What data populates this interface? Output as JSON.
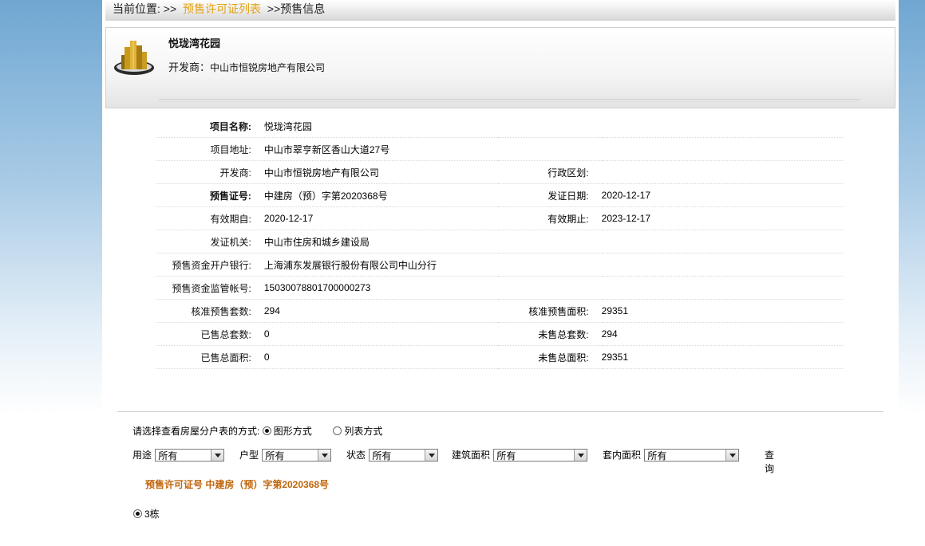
{
  "breadcrumb": {
    "prefix": "当前位置:",
    "sep1": ">>",
    "link": "预售许可证列表",
    "sep2": ">>",
    "current": "预售信息"
  },
  "header": {
    "project_name": "悦珑湾花园",
    "developer_label": "开发商：",
    "developer_name": "中山市恒锐房地产有限公司"
  },
  "info": {
    "project_name": {
      "label": "项目名称:",
      "value": "悦珑湾花园"
    },
    "address": {
      "label": "项目地址:",
      "value": "中山市翠亨新区香山大道27号"
    },
    "developer": {
      "label": "开发商:",
      "value": "中山市恒锐房地产有限公司"
    },
    "district": {
      "label": "行政区划:",
      "value": ""
    },
    "permit_no": {
      "label": "预售证号:",
      "value": "中建房（预）字第2020368号"
    },
    "issue_date": {
      "label": "发证日期:",
      "value": "2020-12-17"
    },
    "valid_from": {
      "label": "有效期自:",
      "value": "2020-12-17"
    },
    "valid_to": {
      "label": "有效期止:",
      "value": "2023-12-17"
    },
    "authority": {
      "label": "发证机关:",
      "value": "中山市住房和城乡建设局"
    },
    "bank": {
      "label": "预售资金开户银行:",
      "value": "上海浦东发展银行股份有限公司中山分行"
    },
    "account": {
      "label": "预售资金监管帐号:",
      "value": "15030078801700000273"
    },
    "approved_units": {
      "label": "核准预售套数:",
      "value": "294"
    },
    "approved_area": {
      "label": "核准预售面积:",
      "value": "29351"
    },
    "sold_units": {
      "label": "已售总套数:",
      "value": "0"
    },
    "unsold_units": {
      "label": "未售总套数:",
      "value": "294"
    },
    "sold_area": {
      "label": "已售总面积:",
      "value": "0"
    },
    "unsold_area": {
      "label": "未售总面积:",
      "value": "29351"
    }
  },
  "view_mode": {
    "prompt": "请选择查看房屋分户表的方式:",
    "graphic": "图形方式",
    "list": "列表方式",
    "selected": "graphic"
  },
  "filters": {
    "usage": {
      "label": "用途",
      "value": "所有"
    },
    "unit_type": {
      "label": "户型",
      "value": "所有"
    },
    "status": {
      "label": "状态",
      "value": "所有"
    },
    "build_area": {
      "label": "建筑面积",
      "value": "所有"
    },
    "inner_area": {
      "label": "套内面积",
      "value": "所有"
    },
    "query_label": "查询"
  },
  "permit_title": "预售许可证号 中建房（预）字第2020368号",
  "buildings": [
    {
      "label": "3栋",
      "selected": true
    }
  ]
}
